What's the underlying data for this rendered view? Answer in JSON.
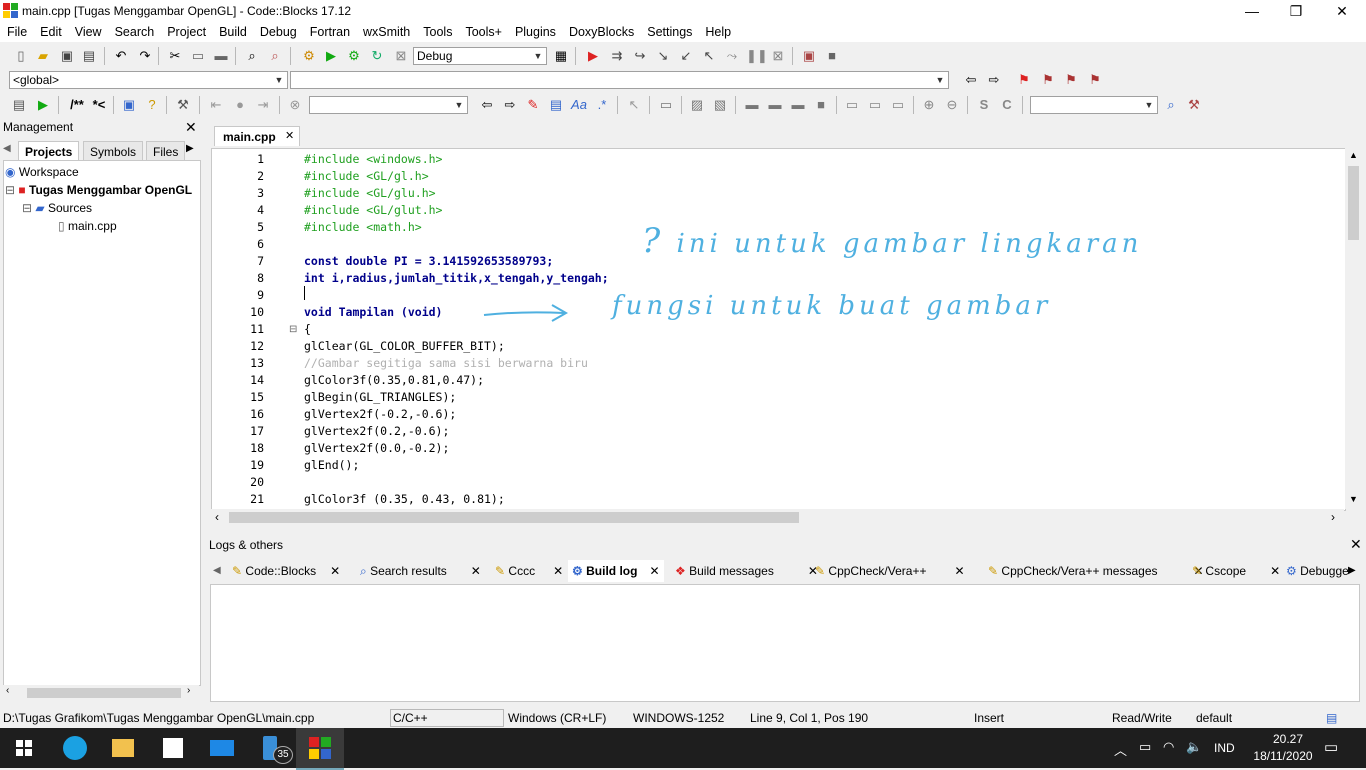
{
  "window": {
    "title": "main.cpp [Tugas Menggambar OpenGL] - Code::Blocks 17.12",
    "minimize": "—",
    "restore": "❐",
    "close": "✕"
  },
  "menu": [
    "File",
    "Edit",
    "View",
    "Search",
    "Project",
    "Build",
    "Debug",
    "Fortran",
    "wxSmith",
    "Tools",
    "Tools+",
    "Plugins",
    "DoxyBlocks",
    "Settings",
    "Help"
  ],
  "toolbar": {
    "build_target": "Debug",
    "scope": "<global>",
    "doxy_comment": "/**",
    "doxy_line": "*<"
  },
  "management": {
    "title": "Management",
    "tabs": [
      "Projects",
      "Symbols",
      "Files"
    ],
    "tree": {
      "workspace": "Workspace",
      "project": "Tugas Menggambar OpenGL",
      "folder": "Sources",
      "file": "main.cpp"
    }
  },
  "editor": {
    "tab": "main.cpp",
    "lines": [
      {
        "n": "1",
        "text": "#include <windows.h>"
      },
      {
        "n": "2",
        "text": "#include <GL/gl.h>"
      },
      {
        "n": "3",
        "text": "#include <GL/glu.h>"
      },
      {
        "n": "4",
        "text": "#include <GL/glut.h>"
      },
      {
        "n": "5",
        "text": "#include <math.h>"
      },
      {
        "n": "6",
        "text": ""
      },
      {
        "n": "7",
        "text": "const double PI = 3.141592653589793;"
      },
      {
        "n": "8",
        "text": "int i,radius,jumlah_titik,x_tengah,y_tengah;"
      },
      {
        "n": "9",
        "text": ""
      },
      {
        "n": "10",
        "text": "void Tampilan (void)"
      },
      {
        "n": "11",
        "text": "{"
      },
      {
        "n": "12",
        "text": "glClear(GL_COLOR_BUFFER_BIT);"
      },
      {
        "n": "13",
        "text": "//Gambar segitiga sama sisi berwarna biru"
      },
      {
        "n": "14",
        "text": "glColor3f(0.35,0.81,0.47);"
      },
      {
        "n": "15",
        "text": "glBegin(GL_TRIANGLES);"
      },
      {
        "n": "16",
        "text": "glVertex2f(-0.2,-0.6);"
      },
      {
        "n": "17",
        "text": "glVertex2f(0.2,-0.6);"
      },
      {
        "n": "18",
        "text": "glVertex2f(0.0,-0.2);"
      },
      {
        "n": "19",
        "text": "glEnd();"
      },
      {
        "n": "20",
        "text": ""
      },
      {
        "n": "21",
        "text": "glColor3f (0.35, 0.43, 0.81);"
      }
    ],
    "annotation1": "ini untuk gambar lingkaran",
    "annotation2": "fungsi untuk buat gambar"
  },
  "logs": {
    "title": "Logs & others",
    "tabs": [
      "Code::Blocks",
      "Search results",
      "Cccc",
      "Build log",
      "Build messages",
      "CppCheck/Vera++",
      "CppCheck/Vera++ messages",
      "Cscope",
      "Debugge"
    ]
  },
  "statusbar": {
    "path": "D:\\Tugas Grafikom\\Tugas Menggambar OpenGL\\main.cpp",
    "lang": "C/C++",
    "eol": "Windows (CR+LF)",
    "encoding": "WINDOWS-1252",
    "position": "Line 9, Col 1, Pos 190",
    "mode": "Insert",
    "access": "Read/Write",
    "profile": "default"
  },
  "taskbar": {
    "lang": "IND",
    "time": "20.27",
    "date": "18/11/2020",
    "badge": "35"
  },
  "colors": {
    "preprocessor": "#20a020",
    "keyword": "#00008b",
    "number": "#e0207a",
    "handwriting": "#4fb0e0"
  }
}
